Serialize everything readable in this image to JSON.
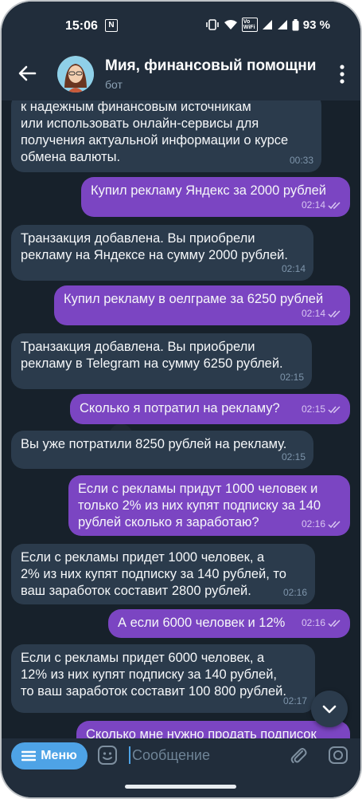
{
  "status": {
    "time": "15:06",
    "n_icon": "N",
    "wifi_label": "Vo WiFi",
    "battery": "93 %"
  },
  "header": {
    "title": "Мия, финансовый помощни",
    "subtitle": "бот"
  },
  "messages": [
    {
      "dir": "in",
      "text": "к надежным финансовым источникам\nили использовать онлайн-сервисы для\nполучения актуальной информации о курсе\nобмена валюты.",
      "time": "00:33"
    },
    {
      "dir": "out",
      "text": "Купил рекламу Яндекс за 2000 рублей",
      "time": "02:14"
    },
    {
      "dir": "in",
      "text": "Транзакция добавлена. Вы приобрели\nрекламу на Яндексе на сумму 2000 рублей.",
      "time": "02:14"
    },
    {
      "dir": "out",
      "text": "Купил рекламу в оелграме за 6250 рублей",
      "time": "02:14"
    },
    {
      "dir": "in",
      "text": "Транзакция добавлена. Вы приобрели\nрекламу в Telegram на сумму 6250 рублей.",
      "time": "02:15"
    },
    {
      "dir": "out",
      "text": "Сколько я потратил на рекламу?",
      "time": "02:15"
    },
    {
      "dir": "in",
      "text": "Вы уже потратили 8250 рублей на рекламу.",
      "time": "02:15"
    },
    {
      "dir": "out",
      "text": "Если с рекламы придут 1000 человек и\nтолько 2% из них купят подписку за 140\nрублей сколько я заработаю?",
      "time": "02:16"
    },
    {
      "dir": "in",
      "text": "Если с рекламы придет 1000 человек, а\n2% из них купят подписку за 140 рублей, то\nваш заработок составит 2800 рублей.",
      "time": "02:16"
    },
    {
      "dir": "out",
      "text": "А если 6000 человек и 12%",
      "time": "02:16"
    },
    {
      "dir": "in",
      "text": "Если с рекламы придет 6000 человек, а\n12% из них купят подписку за 140 рублей,\nто ваш заработок составит 100 800 рублей.",
      "time": "02:17"
    },
    {
      "dir": "out",
      "text": "Сколько мне нужно продать подписок",
      "time": ""
    }
  ],
  "input": {
    "menu_label": "Меню",
    "placeholder": "Сообщение"
  },
  "colors": {
    "incoming": "#2b3b4c",
    "outgoing": "#7b45c2",
    "accent": "#4ea3e6",
    "background": "#17212b"
  },
  "icons": [
    "back-arrow-icon",
    "more-vert-icon",
    "chevron-down-icon",
    "menu-lines-icon",
    "sticker-icon",
    "paperclip-icon",
    "camera-icon",
    "double-check-icon"
  ]
}
